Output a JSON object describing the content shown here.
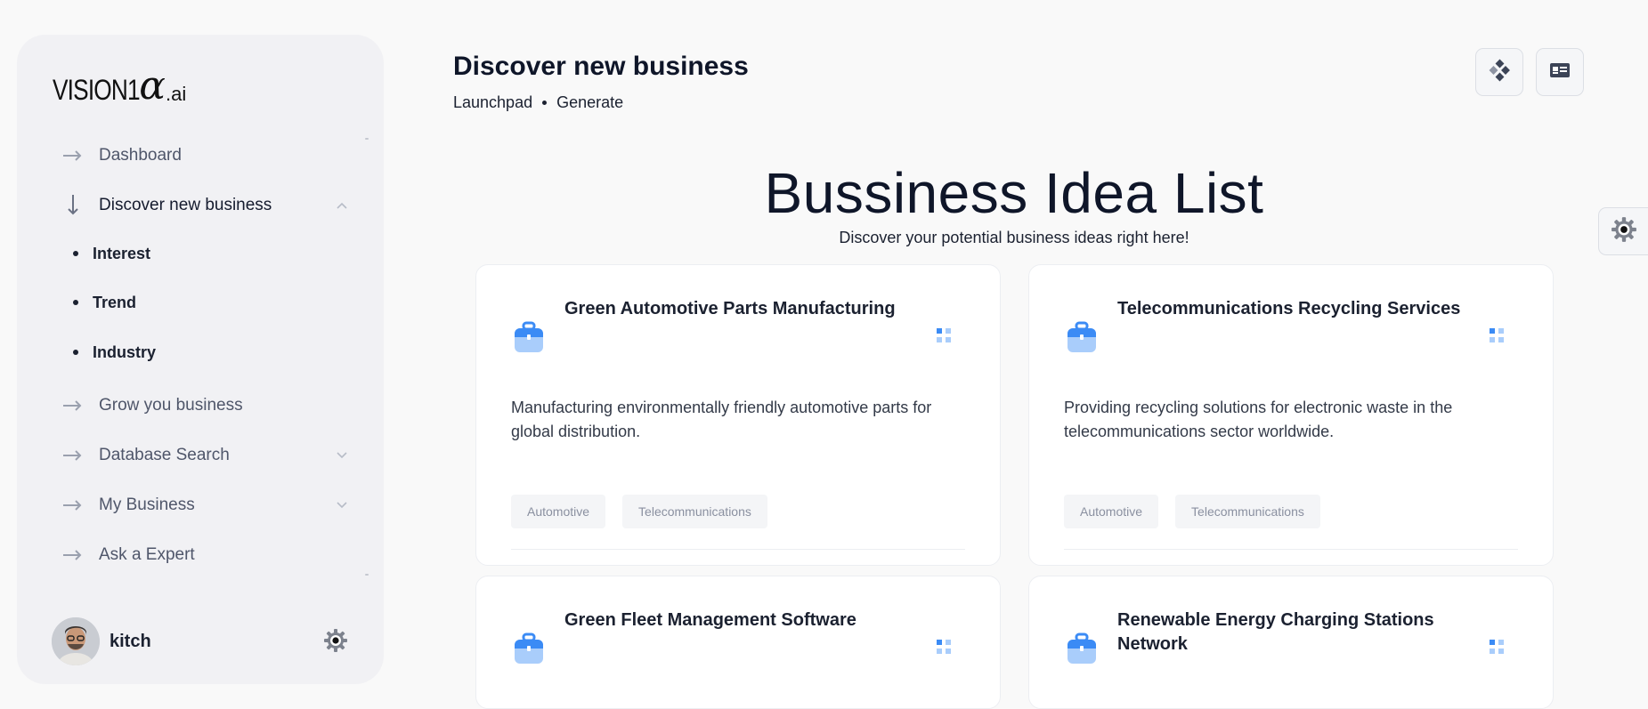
{
  "sidebar": {
    "logo": {
      "main": "VISION1",
      "alpha": "α",
      "suffix": ".ai"
    },
    "nav": [
      {
        "label": "Dashboard",
        "icon": "arrow-right-icon",
        "active": false
      },
      {
        "label": "Discover new business",
        "icon": "arrow-down-icon",
        "active": true,
        "expanded": true,
        "children": [
          {
            "label": "Interest"
          },
          {
            "label": "Trend"
          },
          {
            "label": "Industry"
          }
        ]
      },
      {
        "label": "Grow you business",
        "icon": "arrow-right-icon",
        "active": false
      },
      {
        "label": "Database Search",
        "icon": "arrow-right-icon",
        "active": false,
        "has_dropdown": true
      },
      {
        "label": "My Business",
        "icon": "arrow-right-icon",
        "active": false,
        "has_dropdown": true
      },
      {
        "label": "Ask a Expert",
        "icon": "arrow-right-icon",
        "active": false
      }
    ],
    "user": {
      "name": "kitch"
    }
  },
  "header": {
    "title": "Discover new business",
    "breadcrumb": [
      "Launchpad",
      "Generate"
    ]
  },
  "main": {
    "title": "Bussiness Idea List",
    "subtitle": "Discover your potential business ideas right here!",
    "cards": [
      {
        "title": "Green Automotive Parts Manufacturing",
        "description": "Manufacturing environmentally friendly automotive parts for global distribution.",
        "tags": [
          "Automotive",
          "Telecommunications"
        ]
      },
      {
        "title": "Telecommunications Recycling Services",
        "description": "Providing recycling solutions for electronic waste in the telecommunications sector worldwide.",
        "tags": [
          "Automotive",
          "Telecommunications"
        ]
      },
      {
        "title": "Green Fleet Management Software"
      },
      {
        "title": "Renewable Energy Charging Stations Network"
      }
    ]
  },
  "colors": {
    "accent": "#3b8bf5",
    "accent_light": "#a9cdfb",
    "text_dark": "#0f1629",
    "sidebar_bg": "#f1f1f4"
  }
}
